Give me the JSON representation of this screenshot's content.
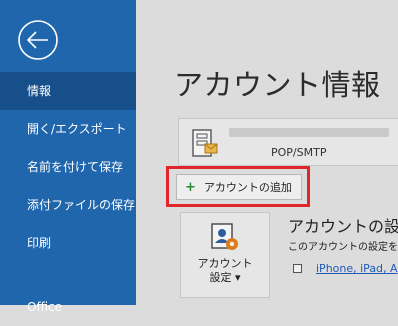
{
  "sidebar": {
    "items": [
      {
        "label": "情報",
        "active": true
      },
      {
        "label": "開く/エクスポート"
      },
      {
        "label": "名前を付けて保存"
      },
      {
        "label": "添付ファイルの保存"
      },
      {
        "label": "印刷"
      },
      {
        "label": "Office"
      }
    ]
  },
  "main": {
    "title": "アカウント情報",
    "account": {
      "type": "POP/SMTP"
    },
    "add_account_label": "アカウントの追加",
    "settings_button": {
      "line1": "アカウント",
      "line2": "設定 ▾"
    },
    "section_heading": "アカウントの設",
    "section_desc": "このアカウントの設定を",
    "device_link": "iPhone, iPad, A"
  },
  "colors": {
    "sidebar": "#1f66ad",
    "active": "#174f8a",
    "highlight": "#e0262b"
  }
}
